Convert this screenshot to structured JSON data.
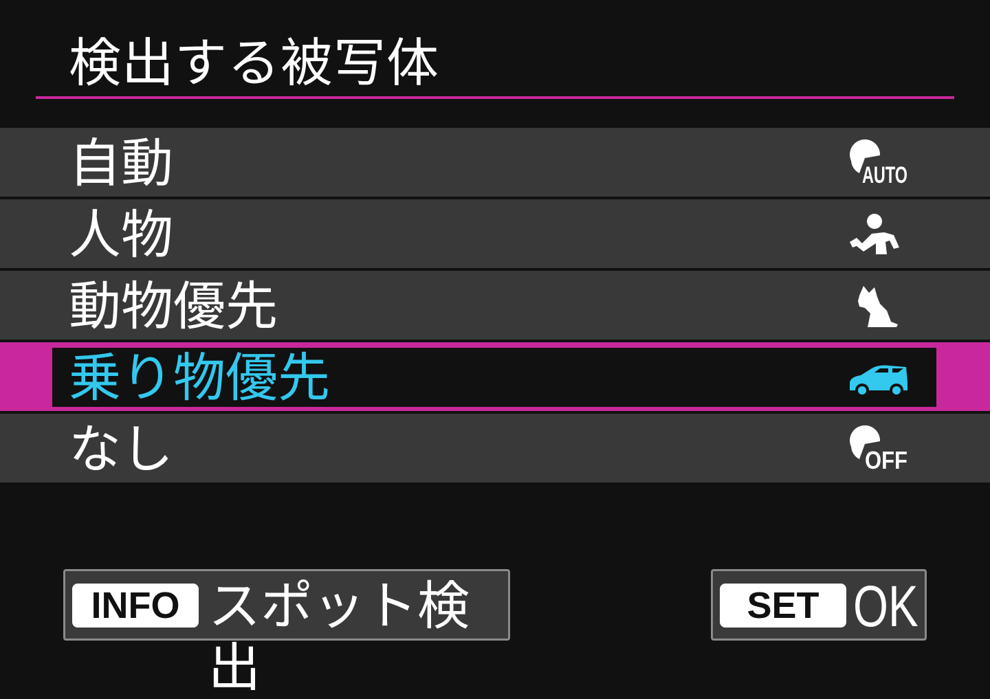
{
  "header": {
    "title": "検出する被写体"
  },
  "menu": {
    "items": [
      {
        "label": "自動",
        "icon": "auto-subject-icon",
        "icon_text": "AUTO"
      },
      {
        "label": "人物",
        "icon": "person-icon"
      },
      {
        "label": "動物優先",
        "icon": "animal-icon"
      },
      {
        "label": "乗り物優先",
        "icon": "vehicle-icon",
        "selected": true
      },
      {
        "label": "なし",
        "icon": "off-subject-icon",
        "icon_text": "OFF"
      }
    ]
  },
  "footer": {
    "info_key": "INFO",
    "info_label": "スポット検出",
    "set_key": "SET",
    "set_label": "OK"
  },
  "colors": {
    "accent": "#c8289c",
    "selected_text": "#33c8ee",
    "background": "#111111",
    "row": "#393939"
  }
}
